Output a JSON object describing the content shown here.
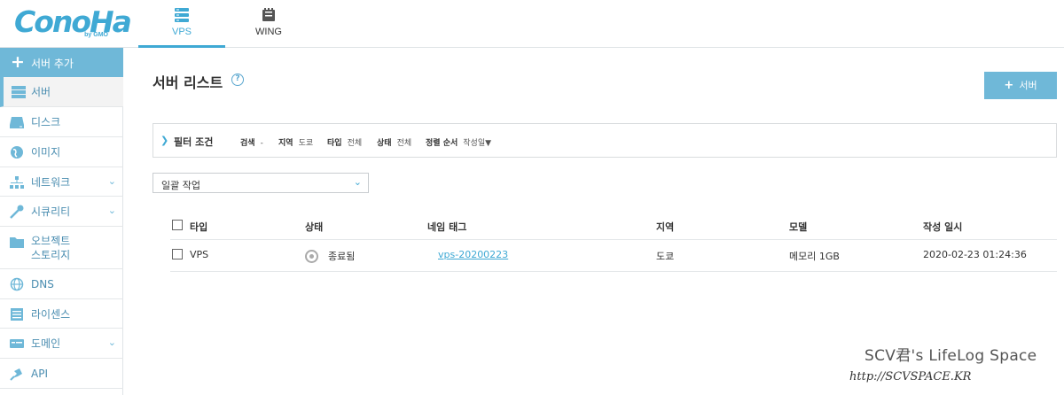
{
  "brand": {
    "logo": "ConoHa",
    "sub": "by GMO"
  },
  "top_tabs": [
    {
      "label": "VPS",
      "icon": "server-icon",
      "active": true
    },
    {
      "label": "WING",
      "icon": "wing-icon",
      "active": false
    }
  ],
  "sidebar": {
    "add_label": "서버 추가",
    "items": [
      {
        "label": "서버",
        "icon": "server-icon",
        "active": true,
        "expandable": false
      },
      {
        "label": "디스크",
        "icon": "disk-icon",
        "active": false,
        "expandable": false
      },
      {
        "label": "이미지",
        "icon": "globe-icon",
        "active": false,
        "expandable": false
      },
      {
        "label": "네트워크",
        "icon": "network-icon",
        "active": false,
        "expandable": true
      },
      {
        "label": "시큐리티",
        "icon": "key-icon",
        "active": false,
        "expandable": true
      },
      {
        "label": "오브젝트\n스토리지",
        "icon": "folder-icon",
        "active": false,
        "expandable": false
      },
      {
        "label": "DNS",
        "icon": "dns-globe-icon",
        "active": false,
        "expandable": false
      },
      {
        "label": "라이센스",
        "icon": "license-icon",
        "active": false,
        "expandable": false
      },
      {
        "label": "도메인",
        "icon": "domain-icon",
        "active": false,
        "expandable": true
      },
      {
        "label": "API",
        "icon": "api-icon",
        "active": false,
        "expandable": false
      }
    ]
  },
  "main": {
    "title": "서버 리스트",
    "help": "?",
    "add_button": "서버",
    "filter": {
      "label": "필터 조건",
      "items": [
        {
          "key": "검색",
          "value": "-"
        },
        {
          "key": "지역",
          "value": "도쿄"
        },
        {
          "key": "타입",
          "value": "전체"
        },
        {
          "key": "상태",
          "value": "전체"
        },
        {
          "key": "정렬 순서",
          "value": "작성일▼"
        }
      ]
    },
    "bulk_action": "일괄 작업",
    "table": {
      "headers": [
        "타입",
        "상태",
        "네임 태그",
        "지역",
        "모델",
        "작성 일시"
      ],
      "rows": [
        {
          "type": "VPS",
          "status": "종료됨",
          "name_tag": "vps-20200223",
          "region": "도쿄",
          "model": "메모리 1GB",
          "created": "2020-02-23 01:24:36"
        }
      ]
    }
  },
  "watermark": {
    "line1": "SCV君's LifeLog Space",
    "line2": "http://SCVSPACE.KR"
  },
  "colors": {
    "accent": "#6fb8d8",
    "link": "#3fa9d4"
  }
}
